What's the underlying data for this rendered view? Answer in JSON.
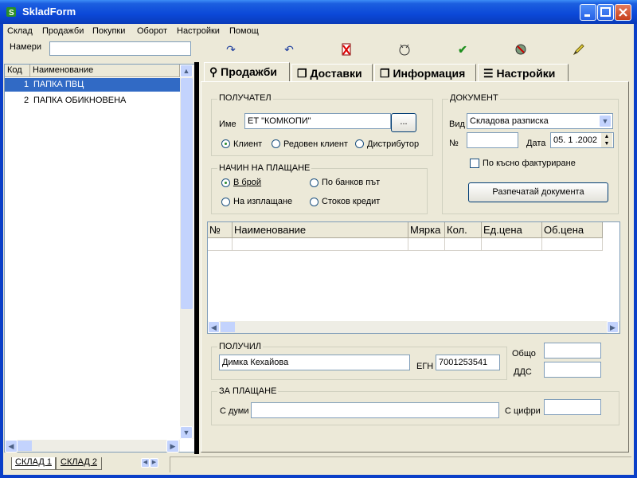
{
  "window": {
    "title": "SkladForm"
  },
  "menu": [
    "Склад",
    "Продажби",
    "Покупки",
    "Оборот",
    "Настройки",
    "Помощ"
  ],
  "toolbar": {
    "find_label": "Намери",
    "find_value": ""
  },
  "left_grid": {
    "columns": [
      "Код",
      "Наименование"
    ],
    "rows": [
      {
        "code": "1",
        "name": "ПАПКА ПВЦ"
      },
      {
        "code": "2",
        "name": "ПАПКА ОБИКНОВЕНА"
      }
    ]
  },
  "warehouse_tabs": [
    "СКЛАД 1",
    "СКЛАД 2"
  ],
  "tabs": [
    "Продажби",
    "Доставки",
    "Информация",
    "Настройки"
  ],
  "recipient": {
    "group_label": "ПОЛУЧАТЕЛ",
    "name_label": "Име",
    "name_value": "ЕТ \"КОМКОПИ\"",
    "browse_label": "...",
    "types": [
      "Клиент",
      "Редовен клиент",
      "Дистрибутор"
    ],
    "selected_type": "Клиент"
  },
  "payment": {
    "group_label": "НАЧИН НА ПЛАЩАНЕ",
    "options": [
      "В брой",
      "По банков път",
      "На изплащане",
      "Стоков кредит"
    ],
    "selected": "В брой"
  },
  "document": {
    "group_label": "ДОКУМЕНТ",
    "type_label": "Вид",
    "type_value": "Складова разписка",
    "number_label": "№",
    "number_value": "",
    "date_label": "Дата",
    "date_value": "05. 1 .2002",
    "late_invoice_label": "По късно фактуриране",
    "late_invoice_checked": false,
    "print_label": "Разпечатай документа"
  },
  "items_grid": {
    "columns": [
      "№",
      "Наименование",
      "Мярка",
      "Кол.",
      "Ед.цена",
      "Об.цена"
    ]
  },
  "received": {
    "group_label": "ПОЛУЧИЛ",
    "name_value": "Димка Кехайова",
    "egn_label": "ЕГН",
    "egn_value": "7001253541",
    "total_label": "Общо",
    "total_value": "",
    "vat_label": "ДДС",
    "vat_value": ""
  },
  "to_pay": {
    "group_label": "ЗА ПЛАЩАНЕ",
    "words_label": "С думи",
    "words_value": "",
    "digits_label": "С цифри",
    "digits_value": ""
  }
}
